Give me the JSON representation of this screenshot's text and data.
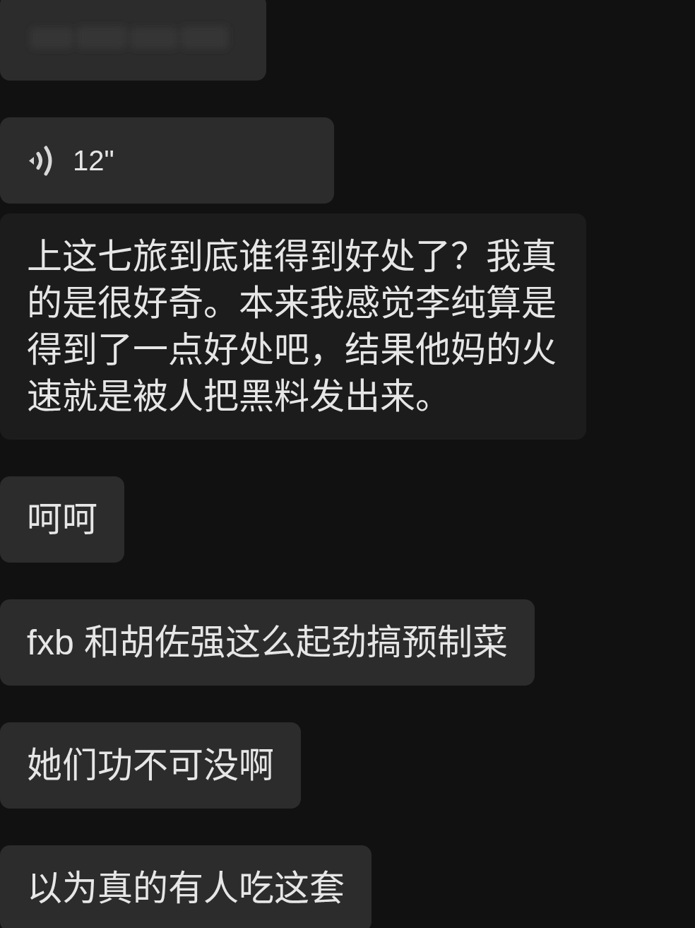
{
  "groups": [
    {
      "messages": [
        {
          "kind": "blurred",
          "color": "#2c2c2c"
        }
      ]
    },
    {
      "messages": [
        {
          "kind": "voice",
          "duration": "12\"",
          "color": "#2c2c2c"
        },
        {
          "kind": "text",
          "text": "上这七旅到底谁得到好处了？我真的是很好奇。本来我感觉李纯算是得到了一点好处吧，结果他妈的火速就是被人把黑料发出来。",
          "color": "#1c1c1c"
        }
      ]
    },
    {
      "messages": [
        {
          "kind": "text",
          "text": "呵呵",
          "color": "#2c2c2c"
        }
      ]
    },
    {
      "messages": [
        {
          "kind": "text",
          "text": "fxb 和胡佐强这么起劲搞预制菜",
          "color": "#2c2c2c"
        }
      ]
    },
    {
      "messages": [
        {
          "kind": "text",
          "text": "她们功不可没啊",
          "color": "#2c2c2c"
        }
      ]
    },
    {
      "messages": [
        {
          "kind": "text",
          "text": "以为真的有人吃这套",
          "color": "#2c2c2c"
        }
      ]
    }
  ]
}
